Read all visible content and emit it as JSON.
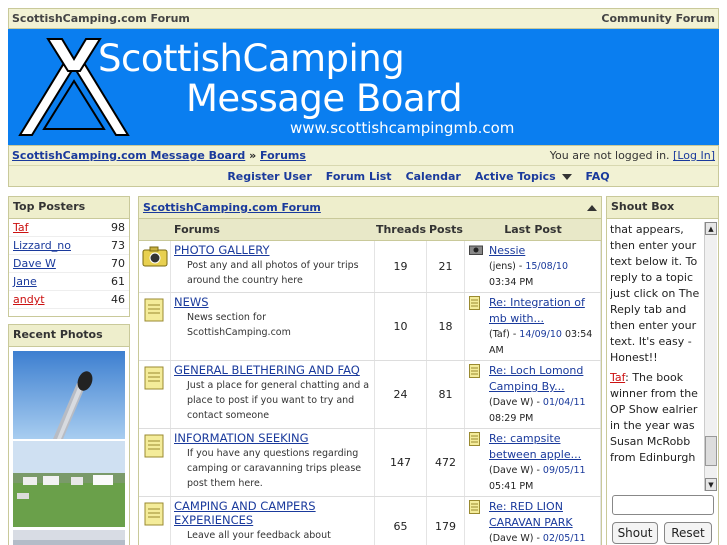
{
  "topbar": {
    "left": "ScottishCamping.com Forum",
    "right": "Community Forum"
  },
  "banner": {
    "line1": "ScottishCamping",
    "line2": "Message Board",
    "url": "www.scottishcampingmb.com"
  },
  "breadcrumb": {
    "home": "ScottishCamping.com Message Board",
    "sep": " » ",
    "current": "Forums",
    "status": "You are not logged in.",
    "login": "[Log In]"
  },
  "nav": [
    "Register User",
    "Forum List",
    "Calendar",
    "Active Topics",
    "FAQ"
  ],
  "top_posters": {
    "title": "Top Posters",
    "items": [
      {
        "name": "Taf",
        "count": "98"
      },
      {
        "name": "Lizzard_no",
        "count": "73"
      },
      {
        "name": "Dave W",
        "count": "70"
      },
      {
        "name": "Jane",
        "count": "61"
      },
      {
        "name": "andyt",
        "count": "46"
      }
    ]
  },
  "recent_photos": {
    "title": "Recent Photos"
  },
  "forum": {
    "title": "ScottishCamping.com Forum",
    "columns": {
      "forums": "Forums",
      "threads": "Threads",
      "posts": "Posts",
      "last": "Last Post"
    },
    "rows": [
      {
        "name": "PHOTO GALLERY",
        "desc": "Post any and all photos of your trips around the country here",
        "threads": "19",
        "posts": "21",
        "last_title": "Nessie",
        "last_by": "(jens) - ",
        "last_date": "15/08/10",
        "last_time": " 03:34 PM"
      },
      {
        "name": "NEWS",
        "desc": "News section for ScottishCamping.com",
        "threads": "10",
        "posts": "18",
        "last_title": "Re: Integration of mb with...",
        "last_by": "(Taf) - ",
        "last_date": "14/09/10",
        "last_time": " 03:54 AM"
      },
      {
        "name": "GENERAL BLETHERING AND FAQ",
        "desc": "Just a place for general chatting and a place to post if you want to try and contact someone",
        "threads": "24",
        "posts": "81",
        "last_title": "Re: Loch Lomond Camping By...",
        "last_by": "(Dave W) - ",
        "last_date": "01/04/11",
        "last_time": " 08:29 PM"
      },
      {
        "name": "INFORMATION SEEKING",
        "desc": "If you have any questions regarding camping or caravanning trips please post them here.",
        "threads": "147",
        "posts": "472",
        "last_title": "Re: campsite between apple...",
        "last_by": "(Dave W) - ",
        "last_date": "09/05/11",
        "last_time": " 05:41 PM"
      },
      {
        "name": "CAMPING AND CAMPERS EXPERIENCES",
        "desc": "Leave all your feedback about campsites",
        "threads": "65",
        "posts": "179",
        "last_title": "Re: RED LION CARAVAN PARK",
        "last_by": "(Dave W) - ",
        "last_date": "02/05/11",
        "last_time": ""
      }
    ]
  },
  "shoutbox": {
    "title": "Shout Box",
    "msg1": "that appears, then enter your text below it. To reply to a topic just click on The Reply tab and then enter your text. It's easy - Honest!!",
    "msg2_user": "Taf",
    "msg2_text": ": The book winner from the OP Show ealrier in the year was Susan McRobb from Edinburgh",
    "shout_label": "Shout",
    "reset_label": "Reset"
  }
}
